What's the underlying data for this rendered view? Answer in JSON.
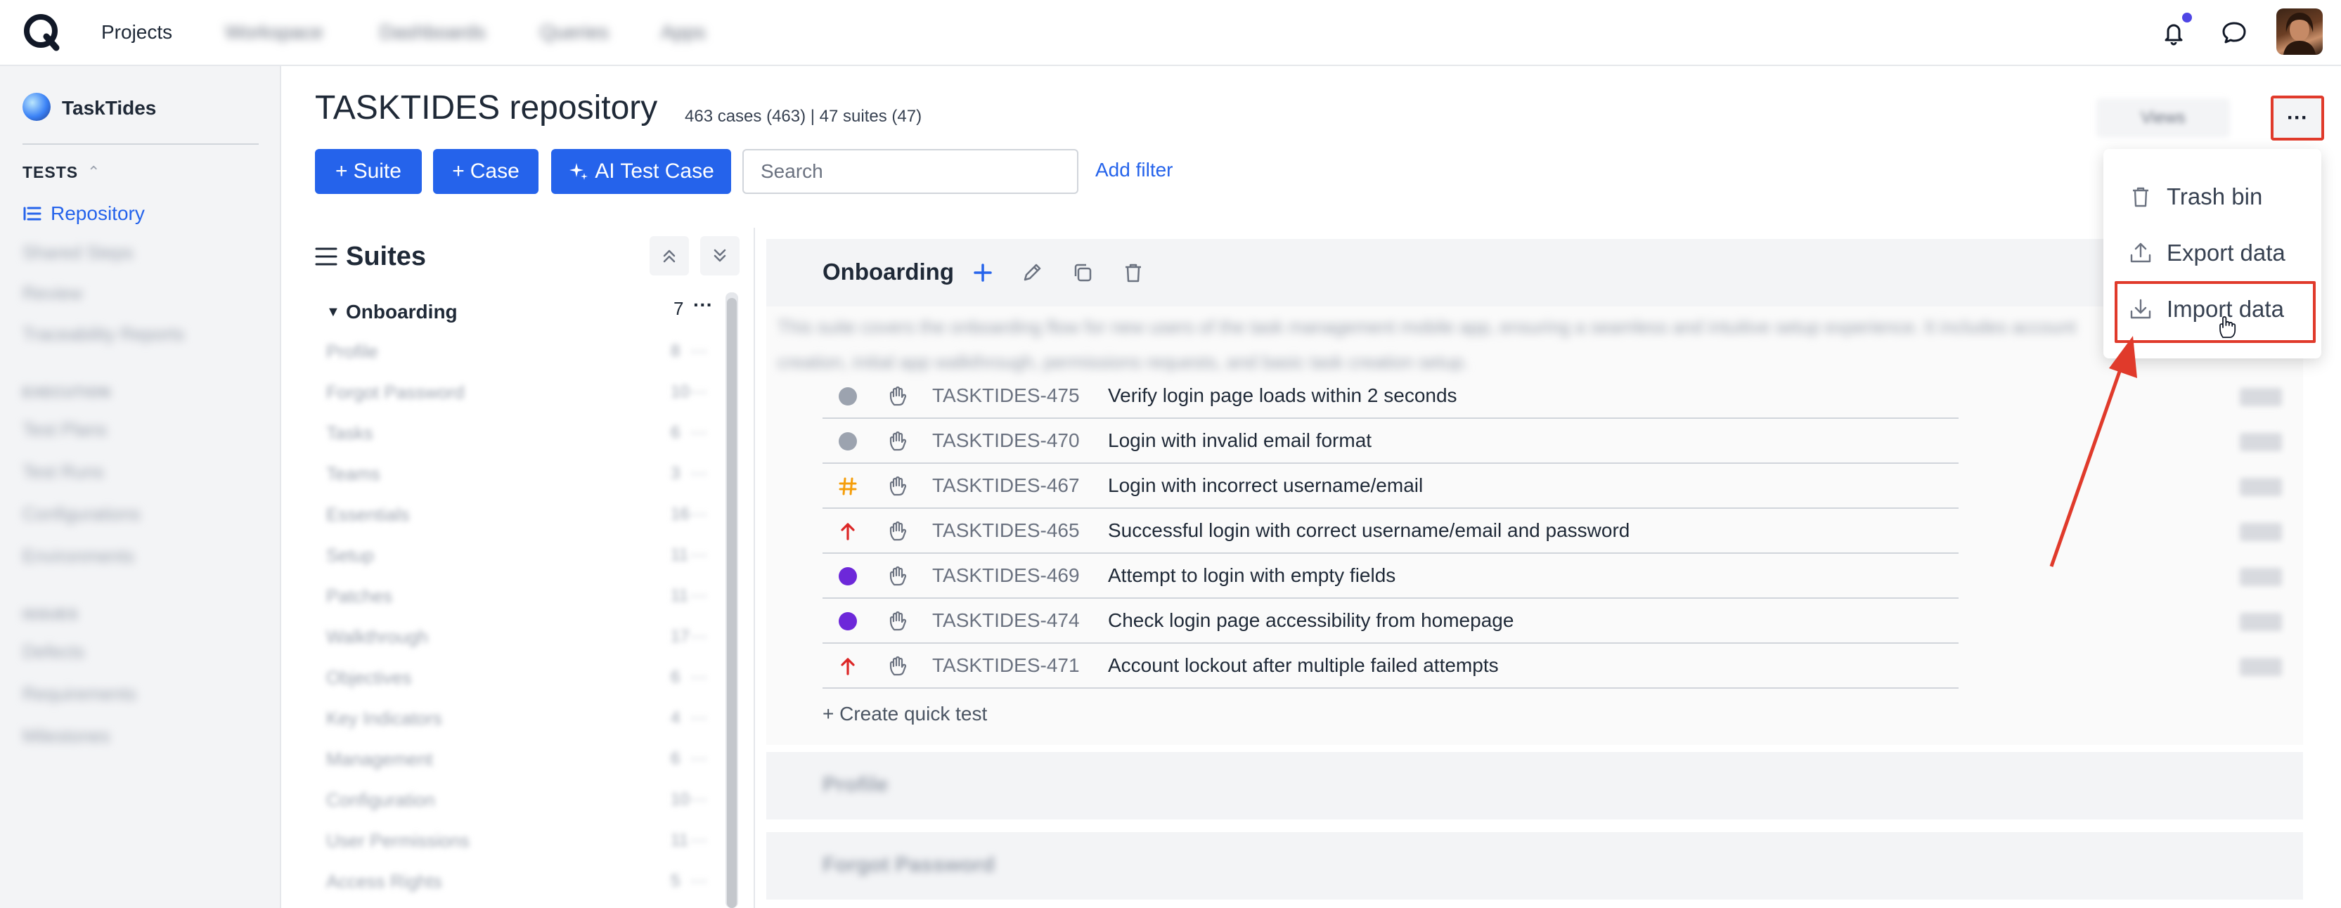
{
  "topbar": {
    "nav": [
      "Projects",
      "Workspace",
      "Dashboards",
      "Queries",
      "Apps"
    ],
    "notification_badge_color": "#4f46e5"
  },
  "sidebar": {
    "project_name": "TaskTides",
    "sections": [
      {
        "label": "TESTS",
        "items": [
          "Repository",
          "Shared Steps",
          "Review",
          "Traceability Reports"
        ]
      },
      {
        "label": "EXECUTION",
        "items": [
          "Test Plans",
          "Test Runs",
          "Configurations",
          "Environments"
        ]
      },
      {
        "label": "ISSUES",
        "items": [
          "Defects",
          "Requirements",
          "Milestones"
        ]
      }
    ],
    "active_item": "Repository"
  },
  "header": {
    "title": "TASKTIDES repository",
    "counts": "463 cases (463) | 47 suites (47)",
    "buttons": {
      "suite": "Suite",
      "case": "Case",
      "ai_case": "AI Test Case",
      "add_filter": "Add filter"
    },
    "search_placeholder": "Search",
    "views_label": "Views",
    "more_label": "···"
  },
  "suites_panel": {
    "title": "Suites",
    "expanded": {
      "name": "Onboarding",
      "count": "7"
    },
    "children": [
      {
        "name": "Profile",
        "count": "8"
      },
      {
        "name": "Forgot Password",
        "count": "10"
      },
      {
        "name": "Tasks",
        "count": "6"
      },
      {
        "name": "Teams",
        "count": "3"
      },
      {
        "name": "Essentials",
        "count": "16"
      },
      {
        "name": "Setup",
        "count": "11"
      },
      {
        "name": "Patches",
        "count": "11"
      },
      {
        "name": "Walkthrough",
        "count": "17"
      },
      {
        "name": "Objectives",
        "count": "6"
      },
      {
        "name": "Key Indicators",
        "count": "4"
      },
      {
        "name": "Management",
        "count": "6"
      },
      {
        "name": "Configuration",
        "count": "10"
      },
      {
        "name": "User Permissions",
        "count": "11"
      },
      {
        "name": "Access Rights",
        "count": "5"
      }
    ]
  },
  "main": {
    "suite_name": "Onboarding",
    "suite_description": "This suite covers the onboarding flow for new users of the task management mobile app, ensuring a seamless and intuitive setup experience. It includes account creation, initial app walkthrough, permissions requests, and basic task creation setup.",
    "test_cases": [
      {
        "id": "TASKTIDES-475",
        "title": "Verify login page loads within 2 seconds",
        "priority": "gray-dot"
      },
      {
        "id": "TASKTIDES-470",
        "title": "Login with invalid email format",
        "priority": "gray-dot"
      },
      {
        "id": "TASKTIDES-467",
        "title": "Login with incorrect username/email",
        "priority": "hash"
      },
      {
        "id": "TASKTIDES-465",
        "title": "Successful login with correct username/email and password",
        "priority": "arrow-up"
      },
      {
        "id": "TASKTIDES-469",
        "title": "Attempt to login with empty fields",
        "priority": "purple-dot"
      },
      {
        "id": "TASKTIDES-474",
        "title": "Check login page accessibility from homepage",
        "priority": "purple-dot"
      },
      {
        "id": "TASKTIDES-471",
        "title": "Account lockout after multiple failed attempts",
        "priority": "arrow-up"
      }
    ],
    "quick_test": "+ Create quick test",
    "collapsed_suites": [
      "Profile",
      "Forgot Password"
    ]
  },
  "menu": {
    "items": [
      "Trash bin",
      "Export data",
      "Import data"
    ]
  },
  "colors": {
    "primary": "#2563eb",
    "annotation_red": "#e03a2b",
    "purple": "#6d28d9",
    "orange": "#f59e0b",
    "red": "#dc2626",
    "gray": "#9ca3af"
  }
}
